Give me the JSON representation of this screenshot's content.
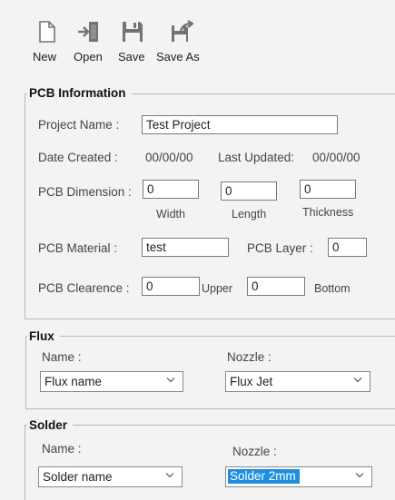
{
  "toolbar": {
    "new_label": "New",
    "open_label": "Open",
    "save_label": "Save",
    "save_as_label": "Save As"
  },
  "pcb_info": {
    "title": "PCB Information",
    "project_name_label": "Project Name :",
    "project_name_value": "Test Project",
    "date_created_label": "Date Created :",
    "date_created_value": "00/00/00",
    "last_updated_label": "Last Updated:",
    "last_updated_value": "00/00/00",
    "dimension_label": "PCB Dimension :",
    "width_value": "0",
    "length_value": "0",
    "thickness_value": "0",
    "width_caption": "Width",
    "length_caption": "Length",
    "thickness_caption": "Thickness",
    "material_label": "PCB Material :",
    "material_value": "test",
    "layer_label": "PCB Layer :",
    "layer_value": "0",
    "clearance_label": "PCB Clearence :",
    "upper_value": "0",
    "upper_caption": "Upper",
    "bottom_value": "0",
    "bottom_caption": "Bottom"
  },
  "flux": {
    "title": "Flux",
    "name_label": "Name :",
    "nozzle_label": "Nozzle :",
    "name_value": "Flux name",
    "nozzle_value": "Flux Jet"
  },
  "solder": {
    "title": "Solder",
    "name_label": "Name :",
    "nozzle_label": "Nozzle :",
    "name_value": "Solder name",
    "nozzle_value": "Solder 2mm"
  },
  "icons": {
    "new": "new-file-icon",
    "open": "open-icon",
    "save": "save-icon",
    "save_as": "save-as-icon",
    "dropdown": "chevron-down-icon"
  },
  "colors": {
    "icon_gray": "#6f7478",
    "selection": "#1e8fe0",
    "background": "#f3f3f3"
  }
}
